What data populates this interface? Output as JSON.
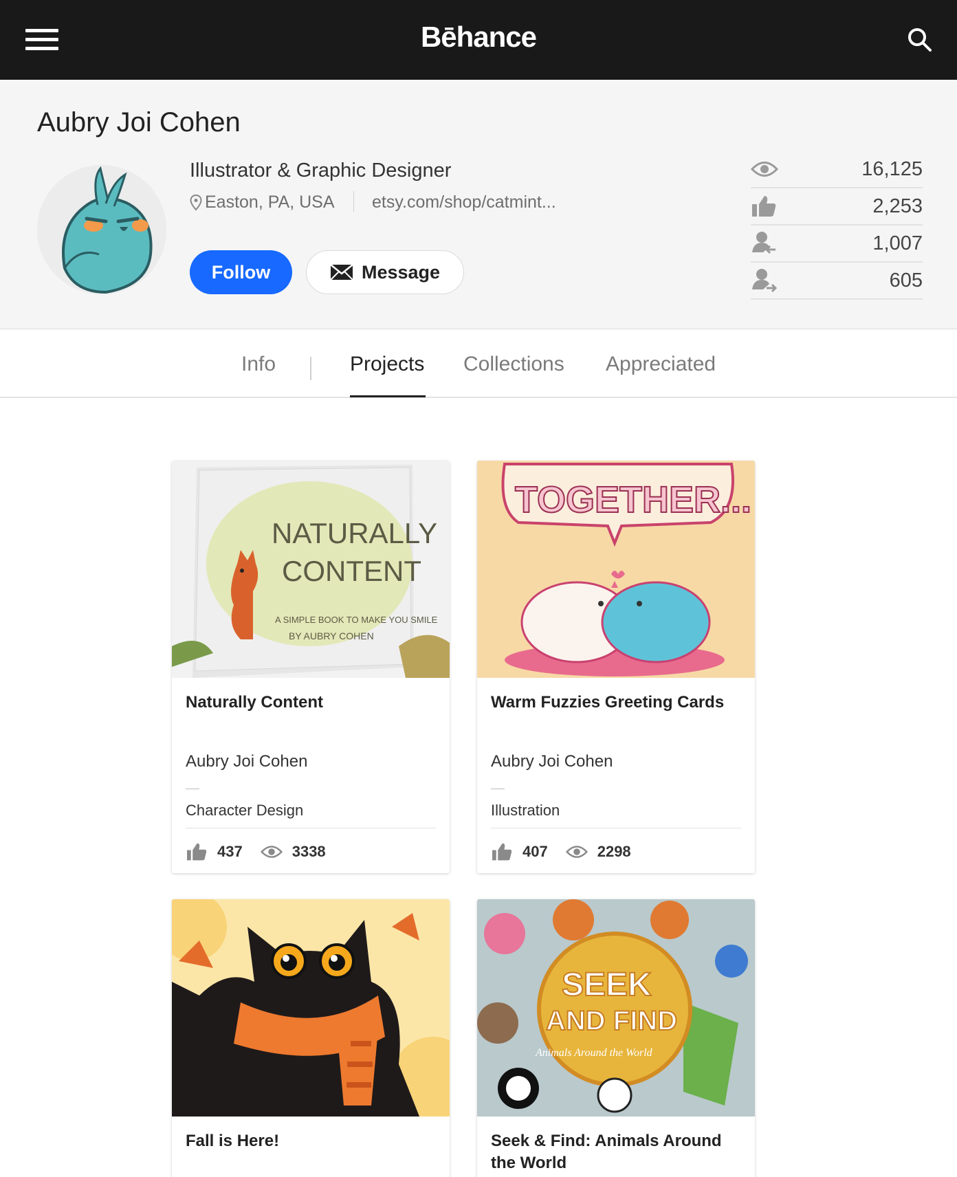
{
  "brand": "Bēhance",
  "profile": {
    "name": "Aubry Joi Cohen",
    "occupation": "Illustrator & Graphic Designer",
    "location": "Easton, PA, USA",
    "website": "etsy.com/shop/catmint...",
    "follow_label": "Follow",
    "message_label": "Message",
    "stats": {
      "views": "16,125",
      "appreciations": "2,253",
      "followers": "1,007",
      "following": "605"
    }
  },
  "tabs": [
    "Info",
    "Projects",
    "Collections",
    "Appreciated"
  ],
  "active_tab": "Projects",
  "projects": [
    {
      "title": "Naturally Content",
      "owner": "Aubry Joi Cohen",
      "field": "Character Design",
      "appreciations": "437",
      "views": "3338",
      "cover_text": [
        "NATURALLY",
        "CONTENT",
        "A SIMPLE BOOK TO MAKE YOU SMILE",
        "BY AUBRY COHEN"
      ]
    },
    {
      "title": "Warm Fuzzies Greeting Cards",
      "owner": "Aubry Joi Cohen",
      "field": "Illustration",
      "appreciations": "407",
      "views": "2298",
      "cover_text": [
        "TOGETHER..."
      ]
    },
    {
      "title": "Fall is Here!",
      "owner": "",
      "field": "",
      "appreciations": "",
      "views": "",
      "cover_text": []
    },
    {
      "title": "Seek & Find: Animals Around the World",
      "owner": "",
      "field": "",
      "appreciations": "",
      "views": "",
      "cover_text": [
        "SEEK",
        "AND FIND",
        "Animals Around the World"
      ]
    }
  ],
  "colors": {
    "topbar": "#191919",
    "follow": "#1769ff",
    "profile_bg": "#f5f5f5"
  }
}
